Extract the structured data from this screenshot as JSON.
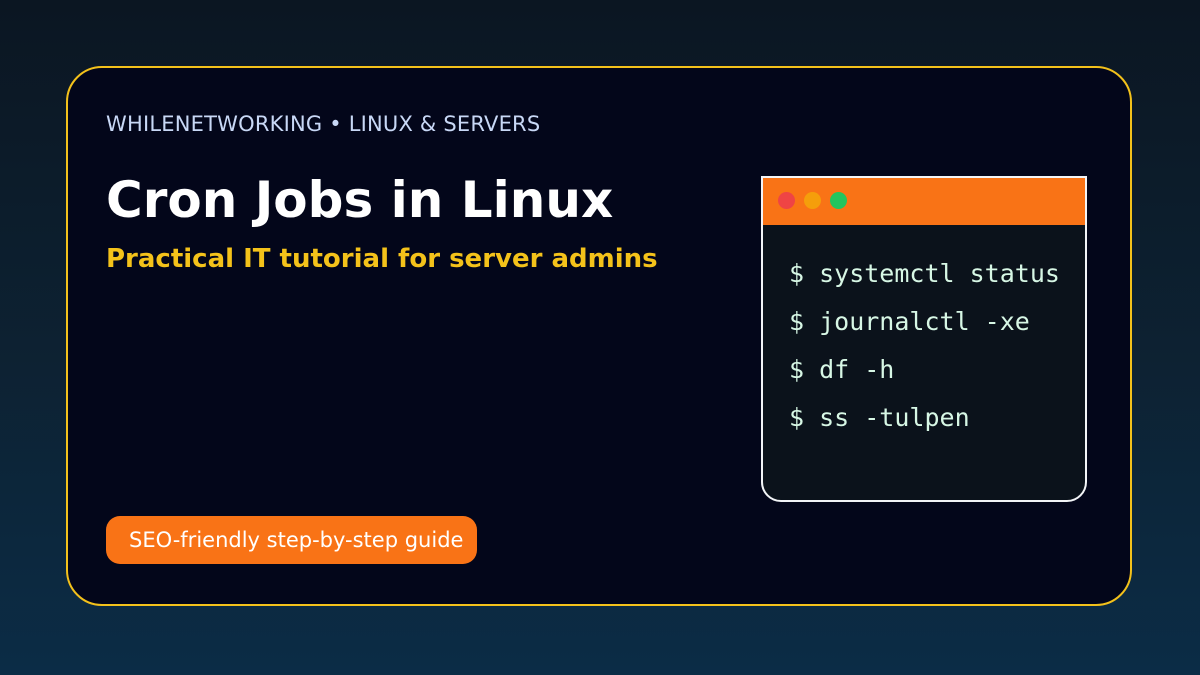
{
  "colors": {
    "background_top": "#0b1622",
    "background_bottom": "#0b2c46",
    "card_background": "#03061a",
    "card_border": "#f3c11b",
    "accent_yellow": "#f4c21a",
    "accent_orange": "#f97316",
    "terminal_text": "#d7f7e5"
  },
  "card": {
    "eyebrow": "WHILENETWORKING • LINUX & SERVERS",
    "title": "Cron Jobs in Linux",
    "subtitle": "Practical IT tutorial for server admins",
    "badge": "SEO-friendly step-by-step guide"
  },
  "terminal": {
    "dots": [
      "close-dot-icon",
      "minimize-dot-icon",
      "maximize-dot-icon"
    ],
    "lines": [
      "$ systemctl status",
      "$ journalctl -xe",
      "$ df -h",
      "$ ss -tulpen"
    ]
  }
}
